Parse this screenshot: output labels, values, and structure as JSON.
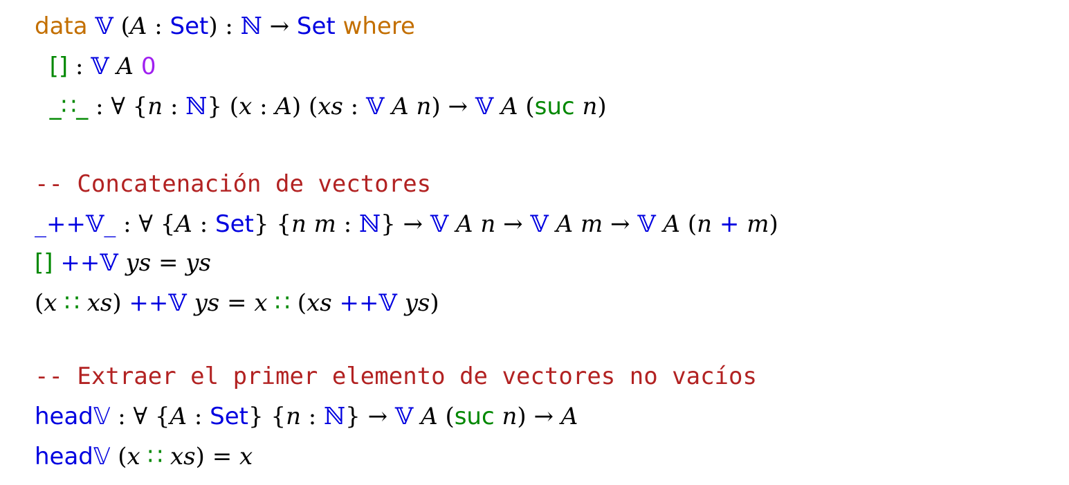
{
  "colors": {
    "keyword": "#c36f00",
    "type": "#0000e0",
    "constructor": "#008800",
    "number": "#a020f0",
    "comment": "#b22222",
    "plain": "#000000"
  },
  "lines": [
    [
      {
        "t": "data",
        "c": "keyword",
        "f": "sans"
      },
      {
        "t": " "
      },
      {
        "t": "𝕍",
        "c": "type",
        "f": "serif"
      },
      {
        "t": " ("
      },
      {
        "t": "A",
        "f": "italic"
      },
      {
        "t": " : "
      },
      {
        "t": "Set",
        "c": "type",
        "f": "sans"
      },
      {
        "t": ") : "
      },
      {
        "t": "ℕ",
        "c": "type",
        "f": "serif"
      },
      {
        "t": " → "
      },
      {
        "t": "Set",
        "c": "type",
        "f": "sans"
      },
      {
        "t": " "
      },
      {
        "t": "where",
        "c": "keyword",
        "f": "sans"
      }
    ],
    [
      {
        "t": "  "
      },
      {
        "t": "[]",
        "c": "constructor",
        "f": "sans"
      },
      {
        "t": " : "
      },
      {
        "t": "𝕍",
        "c": "type",
        "f": "serif"
      },
      {
        "t": " "
      },
      {
        "t": "A",
        "f": "italic"
      },
      {
        "t": " "
      },
      {
        "t": "0",
        "c": "number",
        "f": "sans"
      }
    ],
    [
      {
        "t": "  "
      },
      {
        "t": "_∷_",
        "c": "constructor",
        "f": "sans"
      },
      {
        "t": " : ∀ {"
      },
      {
        "t": "n",
        "f": "italic"
      },
      {
        "t": " : "
      },
      {
        "t": "ℕ",
        "c": "type",
        "f": "serif"
      },
      {
        "t": "} ("
      },
      {
        "t": "x",
        "f": "italic"
      },
      {
        "t": " : "
      },
      {
        "t": "A",
        "f": "italic"
      },
      {
        "t": ") ("
      },
      {
        "t": "xs",
        "f": "italic"
      },
      {
        "t": " : "
      },
      {
        "t": "𝕍",
        "c": "type",
        "f": "serif"
      },
      {
        "t": " "
      },
      {
        "t": "A",
        "f": "italic"
      },
      {
        "t": " "
      },
      {
        "t": "n",
        "f": "italic"
      },
      {
        "t": ") → "
      },
      {
        "t": "𝕍",
        "c": "type",
        "f": "serif"
      },
      {
        "t": " "
      },
      {
        "t": "A",
        "f": "italic"
      },
      {
        "t": " ("
      },
      {
        "t": "suc",
        "c": "constructor",
        "f": "sans"
      },
      {
        "t": " "
      },
      {
        "t": "n",
        "f": "italic"
      },
      {
        "t": ")"
      }
    ],
    [],
    [
      {
        "t": "-- Concatenación de vectores",
        "c": "comment",
        "f": "mono"
      }
    ],
    [
      {
        "t": "_++𝕍_",
        "c": "type",
        "f": "serif"
      },
      {
        "t": " : ∀ {"
      },
      {
        "t": "A",
        "f": "italic"
      },
      {
        "t": " : "
      },
      {
        "t": "Set",
        "c": "type",
        "f": "sans"
      },
      {
        "t": "} {"
      },
      {
        "t": "n m",
        "f": "italic"
      },
      {
        "t": " : "
      },
      {
        "t": "ℕ",
        "c": "type",
        "f": "serif"
      },
      {
        "t": "} → "
      },
      {
        "t": "𝕍",
        "c": "type",
        "f": "serif"
      },
      {
        "t": " "
      },
      {
        "t": "A n",
        "f": "italic"
      },
      {
        "t": " → "
      },
      {
        "t": "𝕍",
        "c": "type",
        "f": "serif"
      },
      {
        "t": " "
      },
      {
        "t": "A m",
        "f": "italic"
      },
      {
        "t": " → "
      },
      {
        "t": "𝕍",
        "c": "type",
        "f": "serif"
      },
      {
        "t": " "
      },
      {
        "t": "A",
        "f": "italic"
      },
      {
        "t": " ("
      },
      {
        "t": "n",
        "f": "italic"
      },
      {
        "t": " "
      },
      {
        "t": "+",
        "c": "type",
        "f": "sans"
      },
      {
        "t": " "
      },
      {
        "t": "m",
        "f": "italic"
      },
      {
        "t": ")"
      }
    ],
    [
      {
        "t": "[]",
        "c": "constructor",
        "f": "sans"
      },
      {
        "t": " "
      },
      {
        "t": "++𝕍",
        "c": "type",
        "f": "serif"
      },
      {
        "t": " "
      },
      {
        "t": "ys",
        "f": "italic"
      },
      {
        "t": " = "
      },
      {
        "t": "ys",
        "f": "italic"
      }
    ],
    [
      {
        "t": "("
      },
      {
        "t": "x",
        "f": "italic"
      },
      {
        "t": " "
      },
      {
        "t": "∷",
        "c": "constructor",
        "f": "sans"
      },
      {
        "t": " "
      },
      {
        "t": "xs",
        "f": "italic"
      },
      {
        "t": ") "
      },
      {
        "t": "++𝕍",
        "c": "type",
        "f": "serif"
      },
      {
        "t": " "
      },
      {
        "t": "ys",
        "f": "italic"
      },
      {
        "t": " = "
      },
      {
        "t": "x",
        "f": "italic"
      },
      {
        "t": " "
      },
      {
        "t": "∷",
        "c": "constructor",
        "f": "sans"
      },
      {
        "t": " ("
      },
      {
        "t": "xs",
        "f": "italic"
      },
      {
        "t": " "
      },
      {
        "t": "++𝕍",
        "c": "type",
        "f": "serif"
      },
      {
        "t": " "
      },
      {
        "t": "ys",
        "f": "italic"
      },
      {
        "t": ")"
      }
    ],
    [],
    [
      {
        "t": "-- Extraer el primer elemento de vectores no vacíos",
        "c": "comment",
        "f": "mono"
      }
    ],
    [
      {
        "t": "head𝕍",
        "c": "type",
        "f": "sans"
      },
      {
        "t": " : ∀ {"
      },
      {
        "t": "A",
        "f": "italic"
      },
      {
        "t": " : "
      },
      {
        "t": "Set",
        "c": "type",
        "f": "sans"
      },
      {
        "t": "} {"
      },
      {
        "t": "n",
        "f": "italic"
      },
      {
        "t": " : "
      },
      {
        "t": "ℕ",
        "c": "type",
        "f": "serif"
      },
      {
        "t": "} → "
      },
      {
        "t": "𝕍",
        "c": "type",
        "f": "serif"
      },
      {
        "t": " "
      },
      {
        "t": "A",
        "f": "italic"
      },
      {
        "t": " ("
      },
      {
        "t": "suc",
        "c": "constructor",
        "f": "sans"
      },
      {
        "t": " "
      },
      {
        "t": "n",
        "f": "italic"
      },
      {
        "t": ") → "
      },
      {
        "t": "A",
        "f": "italic"
      }
    ],
    [
      {
        "t": "head𝕍",
        "c": "type",
        "f": "sans"
      },
      {
        "t": " ("
      },
      {
        "t": "x",
        "f": "italic"
      },
      {
        "t": " "
      },
      {
        "t": "∷",
        "c": "constructor",
        "f": "sans"
      },
      {
        "t": " "
      },
      {
        "t": "xs",
        "f": "italic"
      },
      {
        "t": ") = "
      },
      {
        "t": "x",
        "f": "italic"
      }
    ]
  ]
}
